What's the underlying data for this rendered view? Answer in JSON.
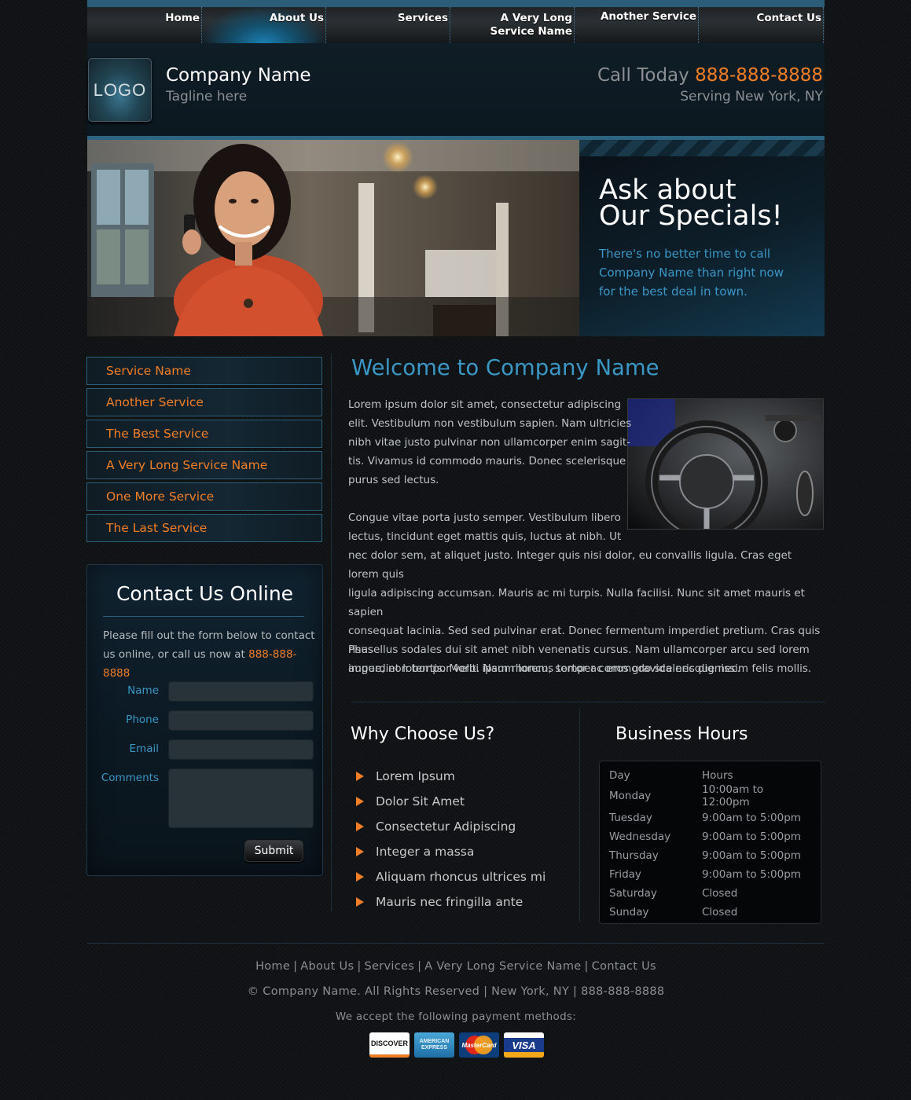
{
  "nav": {
    "items": [
      {
        "label": "Home"
      },
      {
        "label": "About Us"
      },
      {
        "label": "Services"
      },
      {
        "label": "A Very Long\nService Name"
      },
      {
        "label": "Another Service"
      },
      {
        "label": "Contact Us"
      }
    ],
    "active_index": 1
  },
  "header": {
    "logo_text": "LOGO",
    "company_name": "Company Name",
    "tagline": "Tagline here",
    "call_label": "Call Today",
    "phone": "888-888-8888",
    "serving": "Serving New York, NY"
  },
  "banner": {
    "promo_title_line1": "Ask about",
    "promo_title_line2": "Our Specials!",
    "promo_text": "There's no better time to call Company Name than right now for the best deal in town."
  },
  "sidebar": {
    "services": [
      {
        "label": "Service Name"
      },
      {
        "label": "Another Service"
      },
      {
        "label": "The Best Service"
      },
      {
        "label": "A Very Long Service Name"
      },
      {
        "label": "One More Service"
      },
      {
        "label": "The Last Service"
      }
    ],
    "contact": {
      "title": "Contact Us Online",
      "intro": "Please fill out the form below to contact us online, or call us now at",
      "phone": "888-888-8888",
      "fields": {
        "name": "Name",
        "phone": "Phone",
        "email": "Email",
        "comments": "Comments"
      },
      "submit_label": "Submit"
    }
  },
  "main": {
    "title": "Welcome to Company Name",
    "p1_lines": [
      "Lorem ipsum dolor sit amet, consectetur adipiscing",
      "elit. Vestibulum non vestibulum sapien. Nam ultricies",
      "nibh vitae justo pulvinar non ullamcorper enim sagit-",
      "tis. Vivamus id commodo mauris. Donec scelerisque",
      "purus sed lectus."
    ],
    "p2_lines": [
      "Congue vitae porta justo semper. Vestibulum libero",
      "lectus, tincidunt eget mattis quis, luctus at nibh. Ut",
      "nec dolor sem, at aliquet justo. Integer quis nisi dolor, eu convallis ligula. Cras eget lorem quis",
      "ligula adipiscing accumsan. Mauris ac mi turpis. Nulla facilisi. Nunc sit amet mauris et sapien",
      "consequat lacinia. Sed sed pulvinar erat. Donec fermentum imperdiet pretium. Cras quis risus",
      "augue, non tempor velit. Nam rhoncus tortor ac eros gravida nec dignissim felis mollis."
    ],
    "p3_lines": [
      "Phasellus sodales dui sit amet nibh venenatis cursus. Nam ullamcorper arcu sed lorem",
      "imperdiet lobortis. Morbi ipsum lorem, semper commodo scelerisque nec."
    ],
    "why_title": "Why Choose Us?",
    "why_items": [
      "Lorem Ipsum",
      "Dolor Sit Amet",
      "Consectetur Adipiscing",
      "Integer a massa",
      "Aliquam rhoncus ultrices mi",
      "Mauris nec fringilla ante"
    ],
    "hours_title": "Business Hours",
    "hours_header": {
      "day": "Day",
      "hours": "Hours"
    },
    "hours": [
      {
        "day": "Monday",
        "hours": "10:00am to 12:00pm"
      },
      {
        "day": "Tuesday",
        "hours": "9:00am to 5:00pm"
      },
      {
        "day": "Wednesday",
        "hours": "9:00am to 5:00pm"
      },
      {
        "day": "Thursday",
        "hours": "9:00am to 5:00pm"
      },
      {
        "day": "Friday",
        "hours": "9:00am to 5:00pm"
      },
      {
        "day": "Saturday",
        "hours": "Closed"
      },
      {
        "day": "Sunday",
        "hours": "Closed"
      }
    ]
  },
  "footer": {
    "links": [
      "Home",
      "About Us",
      "Services",
      "A Very Long Service Name",
      "Contact Us"
    ],
    "copyright": "© Company Name. All Rights Reserved | New York, NY | 888-888-8888",
    "accept_text": "We accept the following payment methods:",
    "cards": [
      "DISCOVER",
      "AMERICAN EXPRESS",
      "MasterCard",
      "VISA"
    ]
  },
  "colors": {
    "accent_orange": "#f07e26",
    "accent_blue": "#3a97c6",
    "nav_border": "#2b5d78"
  }
}
